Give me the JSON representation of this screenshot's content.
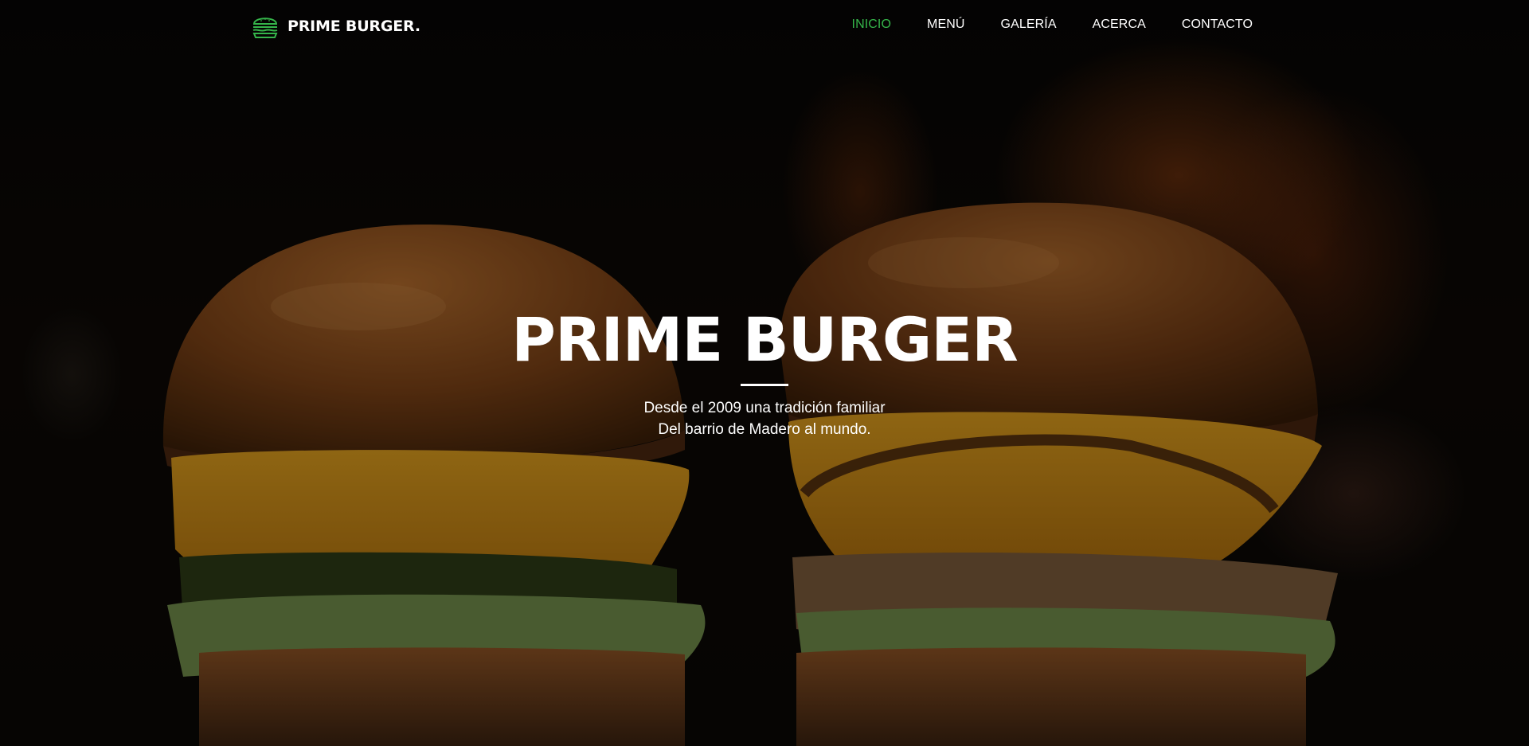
{
  "header": {
    "brand": {
      "name": "PRIME BURGER.",
      "icon": "burger-icon",
      "icon_color": "#35b54a"
    },
    "nav": {
      "items": [
        {
          "label": "INICIO",
          "active": true
        },
        {
          "label": "MENÚ",
          "active": false
        },
        {
          "label": "GALERÍA",
          "active": false
        },
        {
          "label": "ACERCA",
          "active": false
        },
        {
          "label": "CONTACTO",
          "active": false
        }
      ],
      "active_color": "#35b54a"
    }
  },
  "hero": {
    "title": "PRIME BURGER",
    "subtitle_lines": [
      "Desde el 2009 una tradición familiar",
      "Del barrio de Madero al mundo."
    ]
  }
}
